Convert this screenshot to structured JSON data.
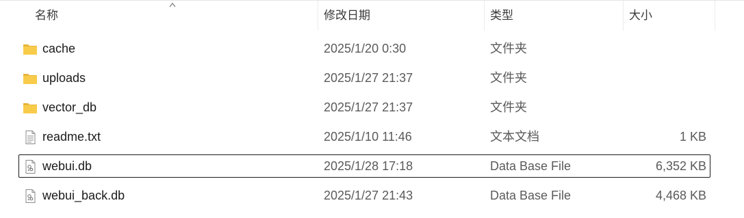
{
  "columns": {
    "name": "名称",
    "date": "修改日期",
    "type": "类型",
    "size": "大小"
  },
  "files": [
    {
      "name": "cache",
      "date": "2025/1/20 0:30",
      "type": "文件夹",
      "size": "",
      "icon": "folder-icon"
    },
    {
      "name": "uploads",
      "date": "2025/1/27 21:37",
      "type": "文件夹",
      "size": "",
      "icon": "folder-icon"
    },
    {
      "name": "vector_db",
      "date": "2025/1/27 21:37",
      "type": "文件夹",
      "size": "",
      "icon": "folder-icon"
    },
    {
      "name": "readme.txt",
      "date": "2025/1/10 11:46",
      "type": "文本文档",
      "size": "1 KB",
      "icon": "text-file-icon"
    },
    {
      "name": "webui.db",
      "date": "2025/1/28 17:18",
      "type": "Data Base File",
      "size": "6,352 KB",
      "icon": "db-file-icon",
      "selected": true
    },
    {
      "name": "webui_back.db",
      "date": "2025/1/27 21:43",
      "type": "Data Base File",
      "size": "4,468 KB",
      "icon": "db-file-icon"
    }
  ]
}
